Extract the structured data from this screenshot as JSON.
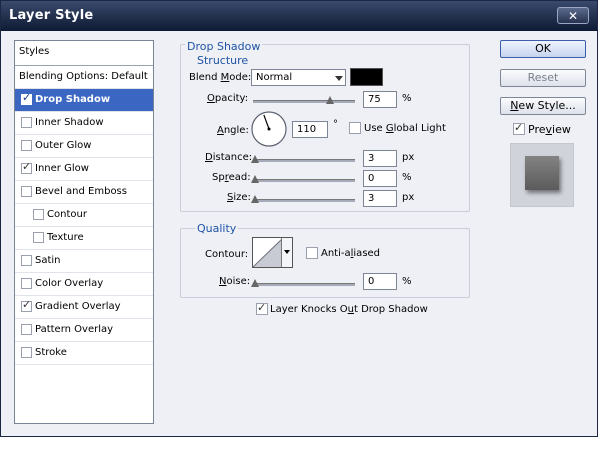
{
  "window": {
    "title": "Layer Style",
    "close_label": "✕"
  },
  "styles_panel": {
    "header": "Styles",
    "blending_options": "Blending Options: Default",
    "items": [
      {
        "label": "Drop Shadow",
        "checked": true,
        "selected": true,
        "sub": false
      },
      {
        "label": "Inner Shadow",
        "checked": false,
        "selected": false,
        "sub": false
      },
      {
        "label": "Outer Glow",
        "checked": false,
        "selected": false,
        "sub": false
      },
      {
        "label": "Inner Glow",
        "checked": true,
        "selected": false,
        "sub": false
      },
      {
        "label": "Bevel and Emboss",
        "checked": false,
        "selected": false,
        "sub": false
      },
      {
        "label": "Contour",
        "checked": false,
        "selected": false,
        "sub": true
      },
      {
        "label": "Texture",
        "checked": false,
        "selected": false,
        "sub": true
      },
      {
        "label": "Satin",
        "checked": false,
        "selected": false,
        "sub": false
      },
      {
        "label": "Color Overlay",
        "checked": false,
        "selected": false,
        "sub": false
      },
      {
        "label": "Gradient Overlay",
        "checked": true,
        "selected": false,
        "sub": false
      },
      {
        "label": "Pattern Overlay",
        "checked": false,
        "selected": false,
        "sub": false
      },
      {
        "label": "Stroke",
        "checked": false,
        "selected": false,
        "sub": false
      }
    ]
  },
  "drop_shadow": {
    "title": "Drop Shadow",
    "structure_title": "Structure",
    "blend_mode": {
      "label_pre": "Blend ",
      "label_u": "M",
      "label_post": "ode:",
      "value": "Normal",
      "color": "#000000"
    },
    "opacity": {
      "label_u": "O",
      "label_post": "pacity:",
      "value": "75",
      "unit": "%",
      "level": 0.75
    },
    "angle": {
      "label_u": "A",
      "label_post": "ngle:",
      "value": "110",
      "unit": "°",
      "degrees": 110,
      "use_global_light": "Use ",
      "global_u": "G",
      "global_post": "lobal Light",
      "use_global_checked": false
    },
    "distance": {
      "label_u": "D",
      "label_post": "istance:",
      "value": "3",
      "unit": "px",
      "level": 0.0
    },
    "spread": {
      "label_pre": "Sp",
      "label_u": "r",
      "label_post": "ead:",
      "value": "0",
      "unit": "%",
      "level": 0.0
    },
    "size": {
      "label_u": "S",
      "label_post": "ize:",
      "value": "3",
      "unit": "px",
      "level": 0.0
    }
  },
  "quality": {
    "title": "Quality",
    "contour_label": "Contour:",
    "anti_aliased": {
      "label_pre": "Anti-a",
      "label_u": "l",
      "label_post": "iased",
      "checked": false
    },
    "noise": {
      "label_u": "N",
      "label_post": "oise:",
      "value": "0",
      "unit": "%",
      "level": 0.0
    }
  },
  "knocks_out": {
    "label": "Layer Knocks O",
    "label_u": "u",
    "label_post": "t Drop Shadow",
    "checked": true
  },
  "buttons": {
    "ok": "OK",
    "reset": "Reset",
    "new_style_pre": "",
    "new_style_u": "N",
    "new_style_post": "ew Style...",
    "preview_pre": "Pre",
    "preview_u": "v",
    "preview_post": "iew",
    "preview_checked": true
  },
  "colors": {
    "accent": "#1f53a5",
    "selection": "#3b67c2",
    "titlebar": "#0e1a33"
  }
}
